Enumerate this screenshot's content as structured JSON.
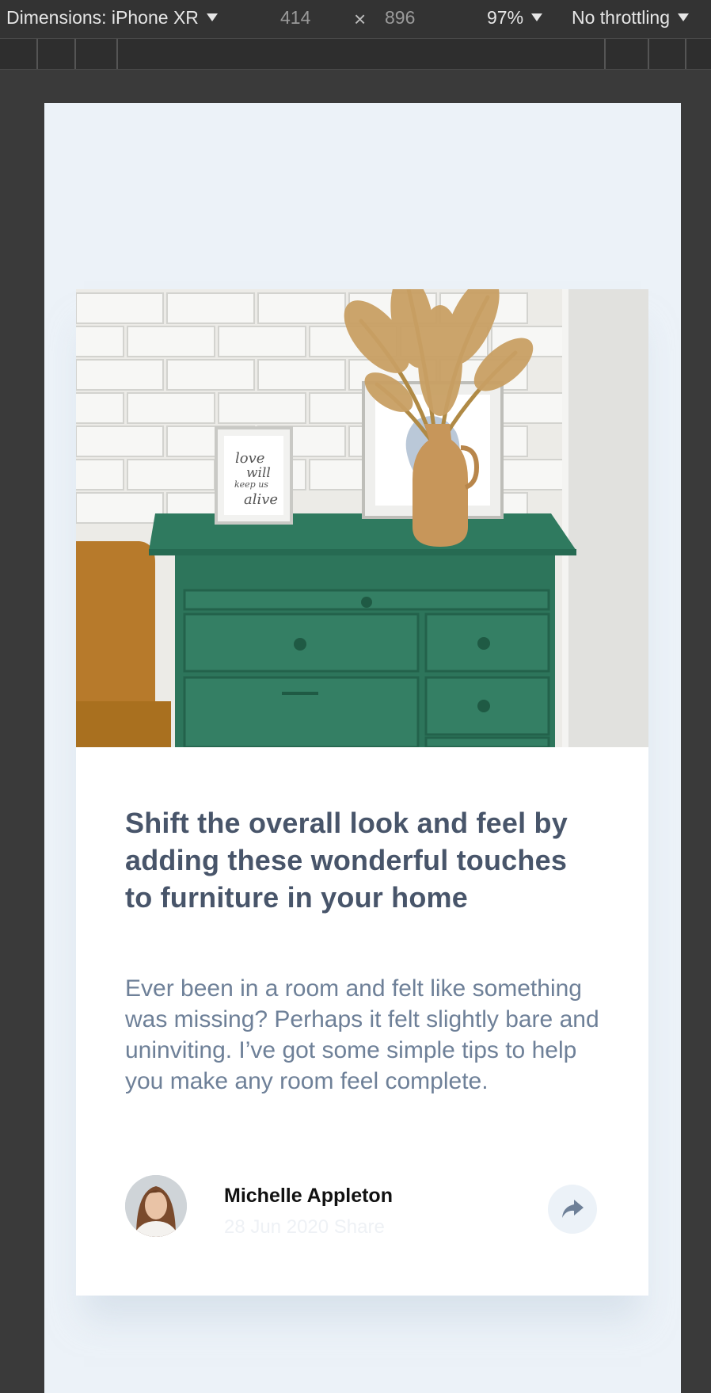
{
  "devtools": {
    "dimensions_label": "Dimensions: iPhone XR",
    "width": "414",
    "times": "×",
    "height": "896",
    "zoom": "97%",
    "throttling": "No throttling"
  },
  "card": {
    "hero_frame_text": [
      "love",
      "will",
      "keep us",
      "alive"
    ],
    "title": "Shift the overall look and feel by adding these wonderful touches to furniture in your home",
    "description": "Ever been in a room and felt like something was missing? Perhaps it felt slightly bare and uninviting. I’ve got some simple tips to help you make any room feel complete.",
    "author": {
      "name": "Michelle Appleton",
      "date": "28 Jun 2020 Share"
    },
    "share_icon": "share-arrow-icon"
  },
  "colors": {
    "page_background": "#ecf2f8",
    "title": "#48556a",
    "body": "#6e8098",
    "cabinet_green": "#2f7a5f"
  }
}
